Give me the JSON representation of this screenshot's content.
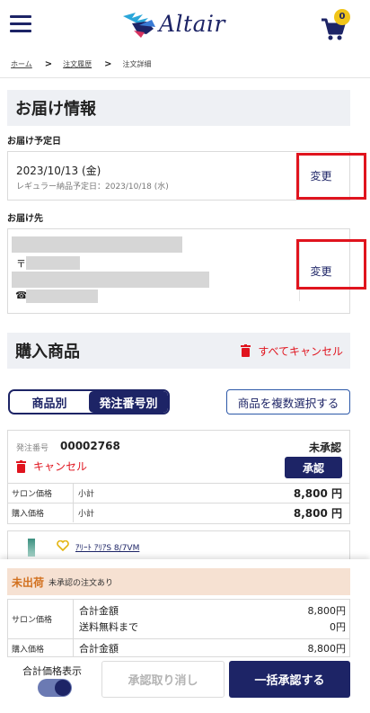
{
  "header": {
    "logo_text": "Altair",
    "cart_count": "0",
    "icons": {
      "menu": "hamburger-menu-icon",
      "cart": "cart-icon",
      "logo": "pegasus-logo-icon"
    }
  },
  "breadcrumb": {
    "items": [
      "ホーム",
      "注文履歴",
      "注文詳細"
    ],
    "separator": ">"
  },
  "delivery": {
    "section_title": "お届け情報",
    "date_label": "お届け予定日",
    "date_value": "2023/10/13 (金)",
    "regular_note": "レギュラー納品予定日：2023/10/18 (水)",
    "change_label": "変更",
    "address_label": "お届け先",
    "postal_symbol": "〒",
    "phone_symbol": "☎",
    "address_change_label": "変更"
  },
  "purchase": {
    "section_title": "購入商品",
    "cancel_all_label": "すべてキャンセル",
    "tabs": [
      {
        "label": "商品別",
        "active": false
      },
      {
        "label": "発注番号別",
        "active": true
      }
    ],
    "multi_select_label": "商品を複数選択する"
  },
  "order": {
    "order_no_label": "発注番号",
    "order_no": "00002768",
    "status": "未承認",
    "cancel_label": "キャンセル",
    "approve_label": "承認",
    "rows": [
      {
        "label": "サロン価格",
        "sub": "小計",
        "value": "8,800 円"
      },
      {
        "label": "購入価格",
        "sub": "小計",
        "value": "8,800 円"
      }
    ],
    "product_name": "ｱﾘｰﾄ ｱﾘｱS 8/7VM"
  },
  "summary": {
    "unshipped_label": "未出荷",
    "unshipped_note": "未承認の注文あり",
    "salon_label": "サロン価格",
    "salon_total_label": "合計金額",
    "salon_total_value": "8,800円",
    "shipping_label": "送料無料まで",
    "shipping_value": "0円",
    "purchase_label": "購入価格",
    "purchase_total_label": "合計金額",
    "purchase_total_value": "8,800円"
  },
  "footer": {
    "price_toggle_label": "合計価格表示",
    "revoke_label": "承認取り消し",
    "bulk_approve_label": "一括承認する"
  },
  "colors": {
    "navy": "#1d2466",
    "red": "#e0141e",
    "warning_bg": "#f6e1d2",
    "warning_text": "#d2701e",
    "badge": "#f0c419"
  }
}
